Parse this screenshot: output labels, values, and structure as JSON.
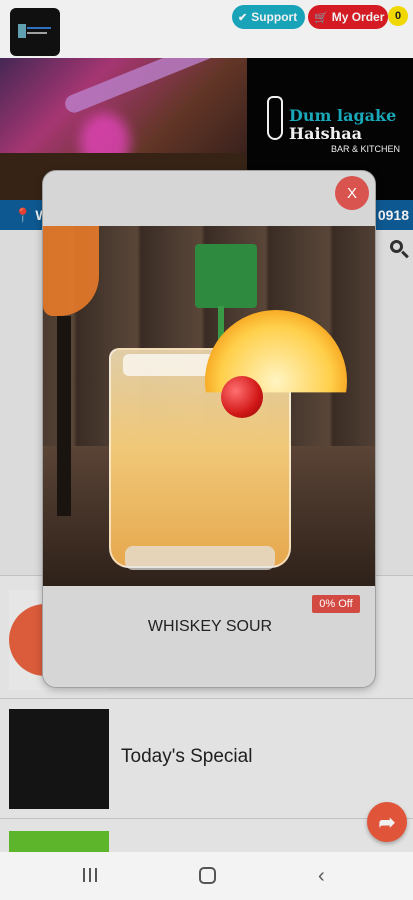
{
  "header": {
    "support_label": "Support",
    "support_icon": "check-circle-icon",
    "order_label": "My Order",
    "order_icon": "cart-icon",
    "order_count": "0"
  },
  "banner": {
    "brand_line1": "Dum lagake",
    "brand_line2": "Haishaa",
    "brand_line3": "BAR & KITCHEN"
  },
  "info_strip": {
    "left_text": "W",
    "right_text": "0918"
  },
  "list": {
    "items": [
      {
        "label": ""
      },
      {
        "label": "Today's Special"
      },
      {
        "label": ""
      }
    ]
  },
  "modal": {
    "close_label": "X",
    "discount": "0% Off",
    "item_name": "WHISKEY SOUR"
  },
  "colors": {
    "support": "#1aaec4",
    "order": "#e21d26",
    "badge": "#ffe500",
    "strip": "#0e5e9a",
    "close": "#d9534f",
    "discount": "#d34a43",
    "fab": "#ee5a3d"
  }
}
